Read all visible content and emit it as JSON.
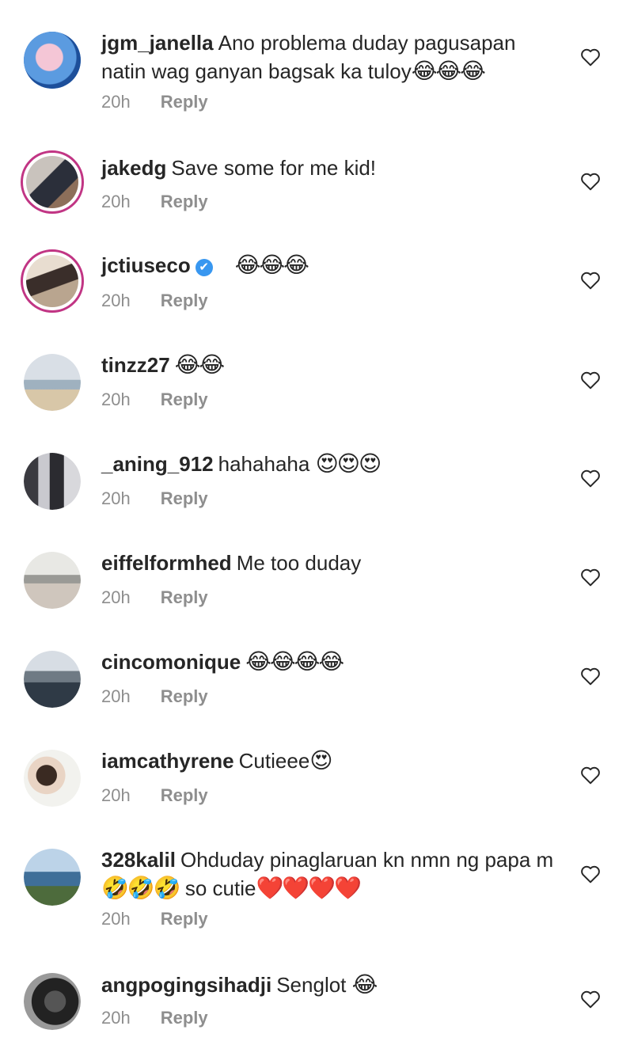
{
  "comments": [
    {
      "username": "jgm_janella",
      "text": "Ano problema duday pagusapan natin wag ganyan bagsak ka tuloy",
      "emoji": "😂😂😂",
      "time": "20h",
      "reply": "Reply"
    },
    {
      "username": "jakedg",
      "text": "Save some for me kid!",
      "emoji": "",
      "time": "20h",
      "reply": "Reply"
    },
    {
      "username": "jctiuseco",
      "text": "",
      "emoji": "😂😂😂",
      "time": "20h",
      "reply": "Reply"
    },
    {
      "username": "tinzz27",
      "text": "",
      "emoji": "😂😂",
      "time": "20h",
      "reply": "Reply"
    },
    {
      "username": "_aning_912",
      "text": "hahahaha",
      "emoji": "😍😍😍",
      "time": "20h",
      "reply": "Reply"
    },
    {
      "username": "eiffelformhed",
      "text": "Me too duday",
      "emoji": "",
      "time": "20h",
      "reply": "Reply"
    },
    {
      "username": "cincomonique",
      "text": "",
      "emoji": "😂😂😂😂",
      "time": "20h",
      "reply": "Reply"
    },
    {
      "username": "iamcathyrene",
      "text": "Cutieee",
      "emoji": "😍",
      "time": "20h",
      "reply": "Reply"
    },
    {
      "username": "328kalil",
      "text": "Ohduday pinaglaruan kn nmn ng papa m",
      "emoji": "🤣🤣🤣",
      "text2": "so cutie",
      "emoji2": "❤️❤️❤️❤️",
      "time": "20h",
      "reply": "Reply"
    },
    {
      "username": "angpogingsihadji",
      "text": "Senglot",
      "emoji": "😂",
      "time": "20h",
      "reply": "Reply"
    }
  ],
  "verified_badge": "✔",
  "icons": {
    "like": "heart-outline-icon",
    "verified": "verified-badge-icon"
  },
  "colors": {
    "text": "#262626",
    "meta": "#8e8e8e",
    "verified": "#3897f0",
    "story_ring": "#c13584"
  }
}
